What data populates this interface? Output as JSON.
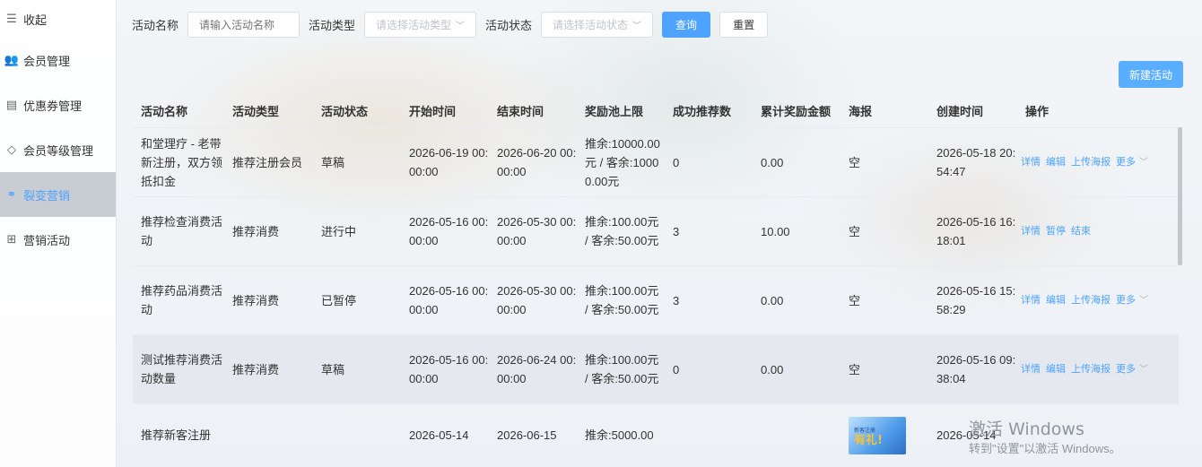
{
  "sidebar": {
    "items": [
      {
        "icon": "collapse-icon",
        "glyph": "☰",
        "label": "收起"
      },
      {
        "icon": "members-icon",
        "glyph": "👥",
        "label": "会员管理"
      },
      {
        "icon": "coupon-icon",
        "glyph": "▤",
        "label": "优惠券管理"
      },
      {
        "icon": "diamond-icon",
        "glyph": "◇",
        "label": "会员等级管理"
      },
      {
        "icon": "share-icon",
        "glyph": "⚭",
        "label": "裂变营销"
      },
      {
        "icon": "gift-icon",
        "glyph": "⊞",
        "label": "营销活动"
      }
    ],
    "active_index": 4
  },
  "filter": {
    "name_label": "活动名称",
    "name_placeholder": "请输入活动名称",
    "type_label": "活动类型",
    "type_placeholder": "请选择活动类型",
    "status_label": "活动状态",
    "status_placeholder": "请选择活动状态",
    "query_label": "查询",
    "reset_label": "重置"
  },
  "new_button_label": "新建活动",
  "table": {
    "headers": [
      "活动名称",
      "活动类型",
      "活动状态",
      "开始时间",
      "结束时间",
      "奖励池上限",
      "成功推荐数",
      "累计奖励金额",
      "海报",
      "创建时间",
      "操作"
    ],
    "rows": [
      {
        "name": "和堂理疗 - 老带新注册，双方领抵扣金",
        "type": "推荐注册会员",
        "status": "草稿",
        "start": "2026-06-19 00:00:00",
        "end": "2026-06-20 00:00:00",
        "pool": "推余:10000.00元 / 客余:10000.00元",
        "count": "0",
        "amount": "0.00",
        "poster": "空",
        "created": "2026-05-18 20:54:47",
        "actions": [
          "详情",
          "编辑",
          "上传海报"
        ],
        "more": "更多"
      },
      {
        "name": "推荐检查消费活动",
        "type": "推荐消费",
        "status": "进行中",
        "start": "2026-05-16 00:00:00",
        "end": "2026-05-30 00:00:00",
        "pool": "推余:100.00元 / 客余:50.00元",
        "count": "3",
        "amount": "10.00",
        "poster": "空",
        "created": "2026-05-16 16:18:01",
        "actions": [
          "详情",
          "暂停",
          "结束"
        ],
        "more": ""
      },
      {
        "name": "推荐药品消费活动",
        "type": "推荐消费",
        "status": "已暂停",
        "start": "2026-05-16 00:00:00",
        "end": "2026-05-30 00:00:00",
        "pool": "推余:100.00元 / 客余:50.00元",
        "count": "3",
        "amount": "0.00",
        "poster": "空",
        "created": "2026-05-16 15:58:29",
        "actions": [
          "详情",
          "编辑",
          "上传海报"
        ],
        "more": "更多"
      },
      {
        "name": "测试推荐消费活动数量",
        "type": "推荐消费",
        "status": "草稿",
        "start": "2026-05-16 00:00:00",
        "end": "2026-06-24 00:00:00",
        "pool": "推余:100.00元 / 客余:50.00元",
        "count": "0",
        "amount": "0.00",
        "poster": "空",
        "created": "2026-05-16 09:38:04",
        "actions": [
          "详情",
          "编辑",
          "上传海报"
        ],
        "more": "更多"
      },
      {
        "name": "推荐新客注册",
        "type": "",
        "status": "",
        "start": "2026-05-14",
        "end": "2026-06-15",
        "pool": "推余:5000.00",
        "count": "",
        "amount": "",
        "poster": "",
        "poster_image": {
          "line1": "新客注册",
          "line2": "有礼!"
        },
        "created": "2026-05-14",
        "actions": [],
        "more": ""
      }
    ]
  },
  "watermark": {
    "line1": "激活 Windows",
    "line2": "转到\"设置\"以激活 Windows。"
  }
}
